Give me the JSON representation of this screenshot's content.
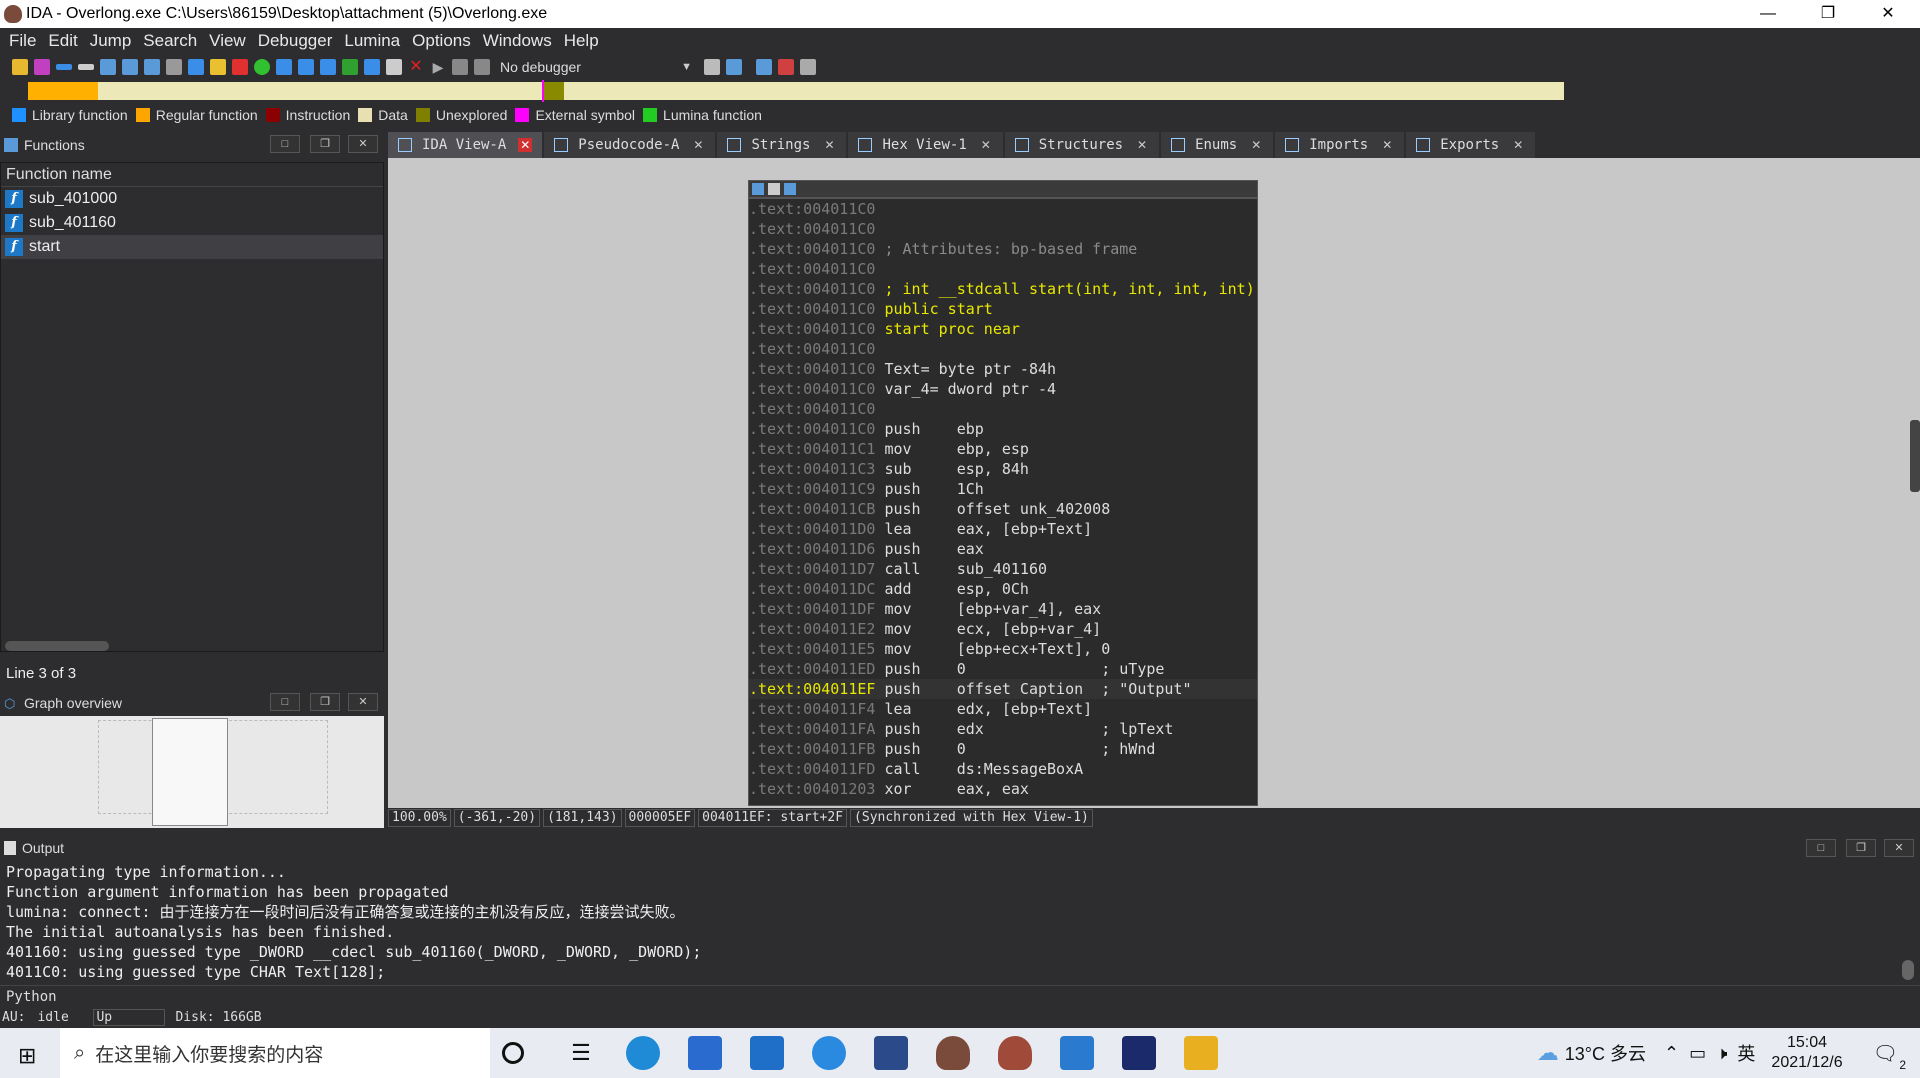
{
  "window": {
    "title": "IDA - Overlong.exe C:\\Users\\86159\\Desktop\\attachment (5)\\Overlong.exe",
    "min": "—",
    "restore": "❐",
    "close": "✕"
  },
  "menu": [
    "File",
    "Edit",
    "Jump",
    "Search",
    "View",
    "Debugger",
    "Lumina",
    "Options",
    "Windows",
    "Help"
  ],
  "toolbar": {
    "debugger": "No debugger"
  },
  "legend": [
    {
      "label": "Library function",
      "color": "#1e90ff"
    },
    {
      "label": "Regular function",
      "color": "#ffa500"
    },
    {
      "label": "Instruction",
      "color": "#8b0000"
    },
    {
      "label": "Data",
      "color": "#e8e0b0"
    },
    {
      "label": "Unexplored",
      "color": "#808000"
    },
    {
      "label": "External symbol",
      "color": "#ff00ff"
    },
    {
      "label": "Lumina function",
      "color": "#22cc22"
    }
  ],
  "functions": {
    "title": "Functions",
    "column": "Function name",
    "items": [
      "sub_401000",
      "sub_401160",
      "start"
    ],
    "status": "Line 3 of 3"
  },
  "graph_overview": {
    "title": "Graph overview"
  },
  "tabs": [
    "IDA View-A",
    "Pseudocode-A",
    "Strings",
    "Hex View-1",
    "Structures",
    "Enums",
    "Imports",
    "Exports"
  ],
  "disasm": [
    {
      "addr": ".text:004011C0",
      "code": ""
    },
    {
      "addr": ".text:004011C0",
      "code": ""
    },
    {
      "addr": ".text:004011C0",
      "code": " ; Attributes: bp-based frame"
    },
    {
      "addr": ".text:004011C0",
      "code": ""
    },
    {
      "addr": ".text:004011C0",
      "code": " ; int __stdcall start(int, int, int, int)"
    },
    {
      "addr": ".text:004011C0",
      "code": " public start"
    },
    {
      "addr": ".text:004011C0",
      "code": " start proc near"
    },
    {
      "addr": ".text:004011C0",
      "code": ""
    },
    {
      "addr": ".text:004011C0",
      "code": " Text= byte ptr -84h"
    },
    {
      "addr": ".text:004011C0",
      "code": " var_4= dword ptr -4"
    },
    {
      "addr": ".text:004011C0",
      "code": ""
    },
    {
      "addr": ".text:004011C0",
      "code": " push    ebp"
    },
    {
      "addr": ".text:004011C1",
      "code": " mov     ebp, esp"
    },
    {
      "addr": ".text:004011C3",
      "code": " sub     esp, 84h"
    },
    {
      "addr": ".text:004011C9",
      "code": " push    1Ch"
    },
    {
      "addr": ".text:004011CB",
      "code": " push    offset unk_402008"
    },
    {
      "addr": ".text:004011D0",
      "code": " lea     eax, [ebp+Text]"
    },
    {
      "addr": ".text:004011D6",
      "code": " push    eax"
    },
    {
      "addr": ".text:004011D7",
      "code": " call    sub_401160"
    },
    {
      "addr": ".text:004011DC",
      "code": " add     esp, 0Ch"
    },
    {
      "addr": ".text:004011DF",
      "code": " mov     [ebp+var_4], eax"
    },
    {
      "addr": ".text:004011E2",
      "code": " mov     ecx, [ebp+var_4]"
    },
    {
      "addr": ".text:004011E5",
      "code": " mov     [ebp+ecx+Text], 0"
    },
    {
      "addr": ".text:004011ED",
      "code": " push    0               ; uType"
    },
    {
      "addr": ".text:004011EF",
      "code": " push    offset Caption  ; \"Output\""
    },
    {
      "addr": ".text:004011F4",
      "code": " lea     edx, [ebp+Text]"
    },
    {
      "addr": ".text:004011FA",
      "code": " push    edx             ; lpText"
    },
    {
      "addr": ".text:004011FB",
      "code": " push    0               ; hWnd"
    },
    {
      "addr": ".text:004011FD",
      "code": " call    ds:MessageBoxA"
    },
    {
      "addr": ".text:00401203",
      "code": " xor     eax, eax"
    }
  ],
  "status": [
    "100.00%",
    "(-361,-20)",
    "(181,143)",
    "000005EF",
    "004011EF: start+2F",
    "(Synchronized with Hex View-1)"
  ],
  "output": {
    "title": "Output",
    "lines": "Propagating type information...\nFunction argument information has been propagated\nlumina: connect: 由于连接方在一段时间后没有正确答复或连接的主机没有反应，连接尝试失败。\nThe initial autoanalysis has been finished.\n401160: using guessed type _DWORD __cdecl sub_401160(_DWORD, _DWORD, _DWORD);\n4011C0: using guessed type CHAR Text[128];"
  },
  "python": "Python",
  "au": {
    "label": "AU:",
    "state": "idle",
    "dir": "Up",
    "disk": "Disk: 166GB"
  },
  "taskbar": {
    "search": "在这里输入你要搜索的内容",
    "weather": "13°C 多云",
    "ime": "英",
    "time": "15:04",
    "date": "2021/12/6",
    "notif": "2"
  }
}
